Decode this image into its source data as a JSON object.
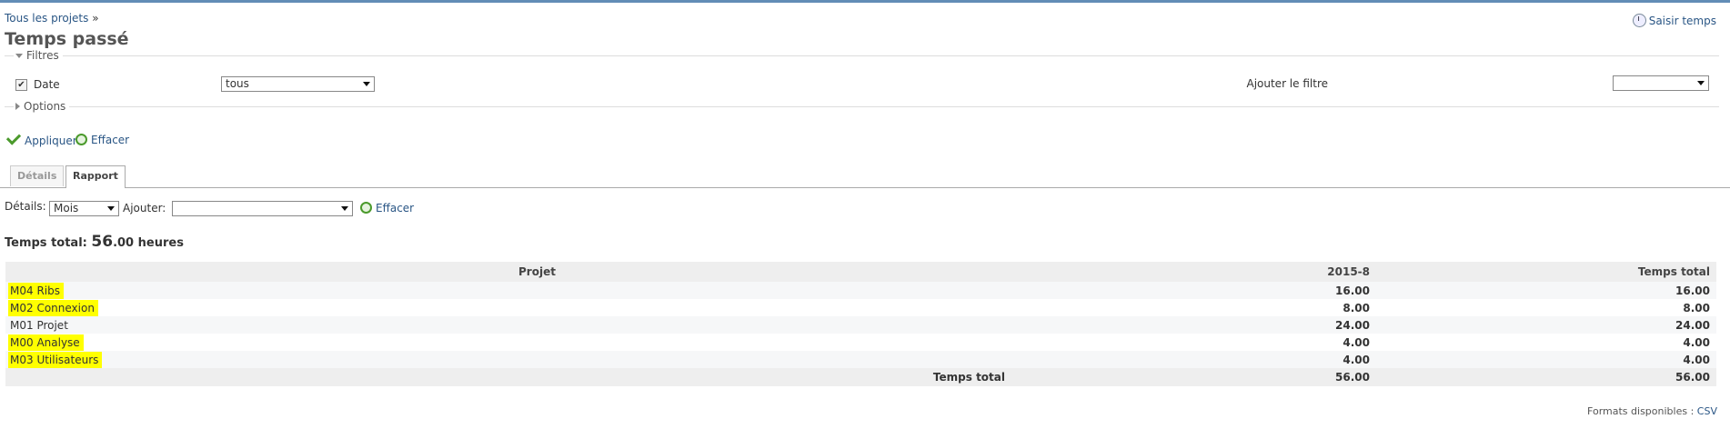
{
  "breadcrumb": {
    "all_projects": "Tous les projets",
    "separator": "»"
  },
  "page_title": "Temps passé",
  "log_time": {
    "label": "Saisir temps",
    "icon": "clock-add-icon"
  },
  "filters": {
    "legend": "Filtres",
    "date": {
      "label": "Date",
      "checked": true,
      "value": "tous"
    },
    "add_filter": {
      "label": "Ajouter le filtre",
      "value": ""
    }
  },
  "options": {
    "legend": "Options"
  },
  "actions": {
    "apply": "Appliquer",
    "clear": "Effacer"
  },
  "tabs": [
    {
      "label": "Détails",
      "active": false
    },
    {
      "label": "Rapport",
      "active": true
    }
  ],
  "criteria": {
    "details_label": "Détails:",
    "details_value": "Mois",
    "add_label": "Ajouter:",
    "add_value": "",
    "clear": "Effacer"
  },
  "total": {
    "label": "Temps total:",
    "int_part": "56",
    "decimals": ".00",
    "unit": "heures"
  },
  "table": {
    "headers": [
      "Projet",
      "2015-8",
      "Temps total"
    ],
    "rows": [
      {
        "project": "M04 Ribs",
        "period": "16.00",
        "total": "16.00",
        "highlighted": true
      },
      {
        "project": "M02 Connexion",
        "period": "8.00",
        "total": "8.00",
        "highlighted": true
      },
      {
        "project": "M01 Projet",
        "period": "24.00",
        "total": "24.00",
        "highlighted": false
      },
      {
        "project": "M00 Analyse",
        "period": "4.00",
        "total": "4.00",
        "highlighted": true
      },
      {
        "project": "M03 Utilisateurs",
        "period": "4.00",
        "total": "4.00",
        "highlighted": true
      }
    ],
    "total_row": {
      "label": "Temps total",
      "period": "56.00",
      "total": "56.00"
    },
    "highlight_color": "#ffff00"
  },
  "formats": {
    "label": "Formats disponibles :",
    "csv": "CSV"
  },
  "colors": {
    "link": "#2a5685",
    "top_bar": "#628db6",
    "ok_green": "#4b9a2c"
  }
}
